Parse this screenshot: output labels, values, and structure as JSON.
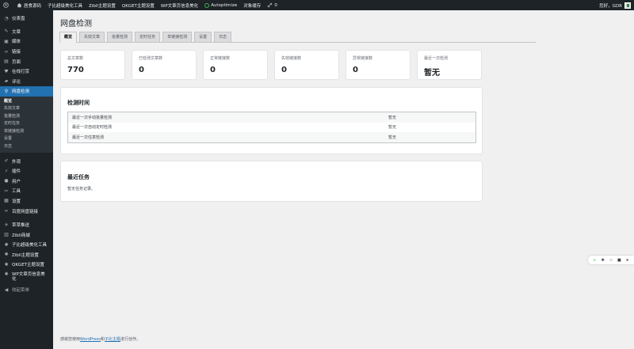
{
  "adminbar": {
    "items": [
      "居食源码",
      "子比超级美化工具",
      "Zibll主题设置",
      "QKGET主题设置",
      "WP文章页信息美化",
      "Autoptimize",
      "对象缓存",
      "0"
    ],
    "greeting": "您好，GDR"
  },
  "sidebar": {
    "menu_top": [
      {
        "label": "仪表盘",
        "icon": "dashboard-icon"
      },
      {
        "label": "文章",
        "icon": "pin-icon"
      },
      {
        "label": "媒体",
        "icon": "media-icon"
      },
      {
        "label": "链接",
        "icon": "link-icon"
      },
      {
        "label": "页面",
        "icon": "page-icon"
      },
      {
        "label": "在线打赏",
        "icon": "heart-icon"
      },
      {
        "label": "评论",
        "icon": "comment-icon"
      },
      {
        "label": "网盘检测",
        "icon": "search-icon"
      }
    ],
    "submenu": [
      "概览",
      "失效文章",
      "批量检测",
      "定时任务",
      "单链接检测",
      "设置",
      "日志"
    ],
    "menu_bottom": [
      {
        "label": "外观",
        "icon": "brush-icon"
      },
      {
        "label": "插件",
        "icon": "plugin-icon"
      },
      {
        "label": "用户",
        "icon": "user-icon"
      },
      {
        "label": "工具",
        "icon": "wrench-icon"
      },
      {
        "label": "设置",
        "icon": "settings-icon"
      },
      {
        "label": "百度网盘链接",
        "icon": "cloud-link-icon"
      }
    ],
    "menu_extra": [
      {
        "label": "草草推送",
        "icon": "push-icon"
      },
      {
        "label": "Zibll商城",
        "icon": "shop-icon"
      },
      {
        "label": "子比超级美化工具",
        "icon": "gear-icon"
      },
      {
        "label": "Zibll主题设置",
        "icon": "gear-icon"
      },
      {
        "label": "QKGET主题设置",
        "icon": "gear-icon"
      },
      {
        "label": "WP文章页信息美化",
        "icon": "gear-icon"
      }
    ],
    "collapse": "收起菜单"
  },
  "page": {
    "title": "网盘检测",
    "tabs": [
      "概览",
      "失效文章",
      "批量检测",
      "定时任务",
      "单链接检测",
      "设置",
      "日志"
    ],
    "stats": [
      {
        "label": "总文章数",
        "value": "770"
      },
      {
        "label": "已检测文章数",
        "value": "0"
      },
      {
        "label": "正常链接数",
        "value": "0"
      },
      {
        "label": "失效链接数",
        "value": "0"
      },
      {
        "label": "异常链接数",
        "value": "0"
      },
      {
        "label": "最近一次检测",
        "value": "暂无"
      }
    ],
    "detect_time": {
      "title": "检测时间",
      "rows": [
        {
          "label": "最近一次手动批量检测",
          "value": "暂无"
        },
        {
          "label": "最近一次自动定时检测",
          "value": "暂无"
        },
        {
          "label": "最近一次任意检测",
          "value": "暂无"
        }
      ]
    },
    "recent_tasks": {
      "title": "最近任务",
      "empty": "暂无任务记录。"
    },
    "footer": {
      "prefix": "感谢您使用",
      "link1": "WordPress",
      "mid": "和",
      "link2": "子比主题",
      "suffix": "进行创作。"
    },
    "float_toolbar": [
      "link-icon",
      "gear-icon",
      "code-icon",
      "box-icon",
      "send-icon"
    ]
  }
}
